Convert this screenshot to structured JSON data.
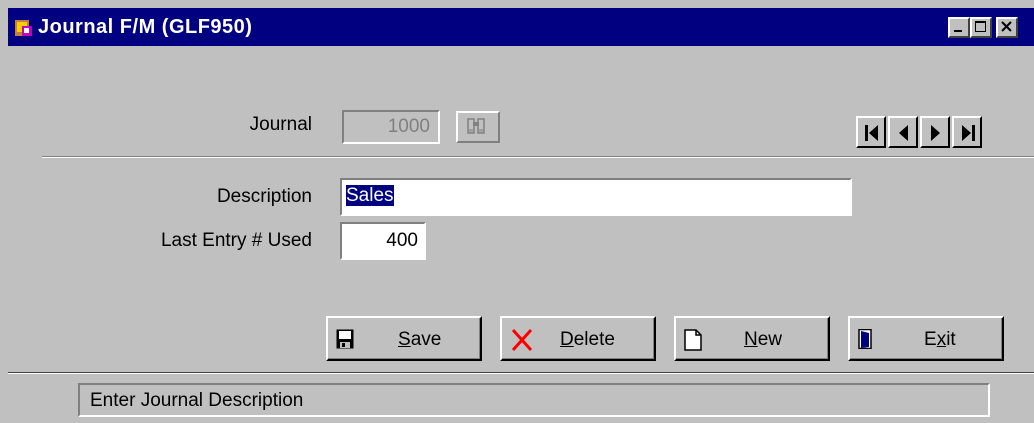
{
  "window": {
    "title": "Journal F/M (GLF950)"
  },
  "form": {
    "journal_label": "Journal",
    "journal_value": "1000",
    "description_label": "Description",
    "description_value": "Sales",
    "last_entry_label": "Last Entry # Used",
    "last_entry_value": "400"
  },
  "buttons": {
    "save_pre": "",
    "save_key": "S",
    "save_post": "ave",
    "delete_pre": "",
    "delete_key": "D",
    "delete_post": "elete",
    "new_pre": "",
    "new_key": "N",
    "new_post": "ew",
    "exit_pre": "E",
    "exit_key": "x",
    "exit_post": "it"
  },
  "status": {
    "message": "Enter Journal Description"
  },
  "colors": {
    "title_bar": "#000080",
    "window_bg": "#c0c0c0",
    "selection": "#000080",
    "delete_icon": "#ff0000"
  },
  "icons": {
    "app": "journal-app-icon",
    "lookup": "binoculars-icon",
    "save": "floppy-disk-icon",
    "delete": "red-x-icon",
    "new": "blank-page-icon",
    "exit": "door-icon"
  }
}
